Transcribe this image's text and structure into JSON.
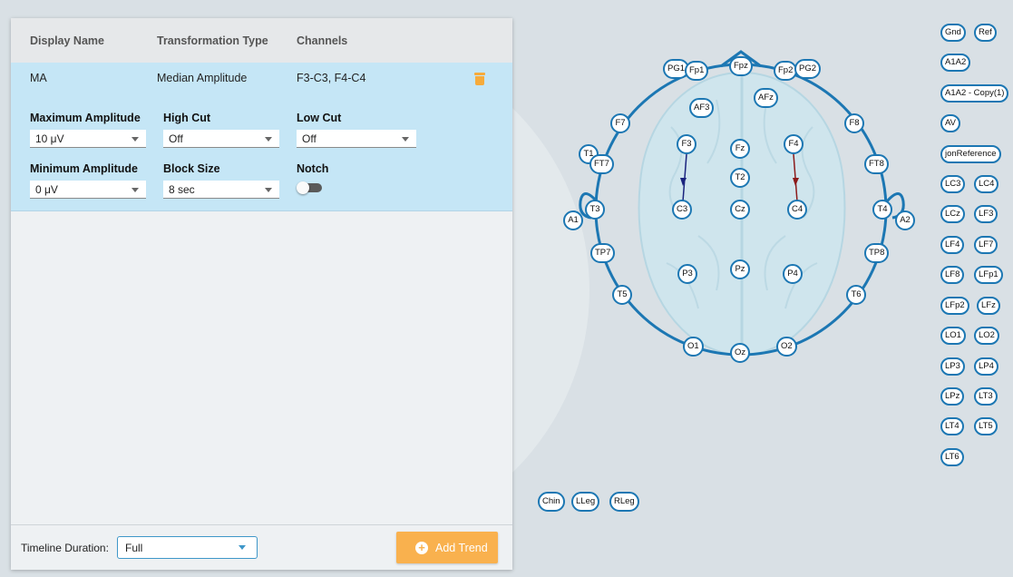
{
  "table": {
    "headers": [
      "Display Name",
      "Transformation Type",
      "Channels"
    ],
    "selected_row": {
      "display_name": "MA",
      "transformation_type": "Median Amplitude",
      "channels": "F3-C3, F4-C4"
    }
  },
  "form": {
    "max_amplitude_label": "Maximum Amplitude",
    "max_amplitude_value": "10 μV",
    "high_cut_label": "High Cut",
    "high_cut_value": "Off",
    "low_cut_label": "Low Cut",
    "low_cut_value": "Off",
    "min_amplitude_label": "Minimum Amplitude",
    "min_amplitude_value": "0 μV",
    "block_size_label": "Block Size",
    "block_size_value": "8 sec",
    "notch_label": "Notch",
    "notch_enabled": false
  },
  "footer": {
    "timeline_label": "Timeline Duration:",
    "timeline_value": "Full",
    "add_trend_label": "Add Trend"
  },
  "colors": {
    "accent": "#1c77b3",
    "button": "#f9b14e",
    "selected_row": "#c5e6f6",
    "montage_line_left": "#1a237e",
    "montage_line_right": "#8b1a1a"
  },
  "electrodes": {
    "head": [
      "Fpz",
      "PG1",
      "Fp1",
      "Fp2",
      "PG2",
      "AFz",
      "AF3",
      "F7",
      "F8",
      "F3",
      "Fz",
      "F4",
      "T1",
      "FT7",
      "FT8",
      "T2",
      "A1",
      "T3",
      "C3",
      "Cz",
      "C4",
      "T4",
      "A2",
      "TP7",
      "TP8",
      "P3",
      "Pz",
      "P4",
      "T5",
      "T6",
      "O1",
      "Oz",
      "O2"
    ],
    "extra": [
      "Chin",
      "LLeg",
      "RLeg"
    ],
    "reference": [
      "Gnd",
      "Ref",
      "A1A2",
      "A1A2 - Copy(1)",
      "AV",
      "jonReference",
      "LC3",
      "LC4",
      "LCz",
      "LF3",
      "LF4",
      "LF7",
      "LF8",
      "LFp1",
      "LFp2",
      "LFz",
      "LO1",
      "LO2",
      "LP3",
      "LP4",
      "LPz",
      "LT3",
      "LT4",
      "LT5",
      "LT6"
    ]
  }
}
